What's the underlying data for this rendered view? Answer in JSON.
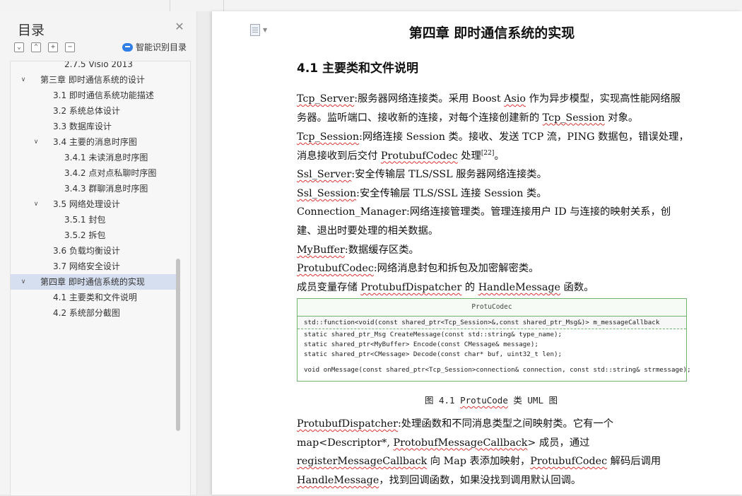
{
  "sidebar": {
    "title": "目录",
    "smart_label": "智能识别目录",
    "toc": [
      {
        "label": "2.7.5 Visio 2013",
        "level": 4,
        "arrow": ""
      },
      {
        "label": "第三章 即时通信系统的设计",
        "level": 1,
        "arrow": "∨"
      },
      {
        "label": "3.1 即时通信系统功能描述",
        "level": 2,
        "arrow": ""
      },
      {
        "label": "3.2 系统总体设计",
        "level": 2,
        "arrow": ""
      },
      {
        "label": "3.3 数据库设计",
        "level": 2,
        "arrow": ""
      },
      {
        "label": "3.4 主要的消息时序图",
        "level": 2,
        "arrow": "∨"
      },
      {
        "label": "3.4.1 未读消息时序图",
        "level": 3,
        "arrow": ""
      },
      {
        "label": "3.4.2 点对点私聊时序图",
        "level": 3,
        "arrow": ""
      },
      {
        "label": "3.4.3 群聊消息时序图",
        "level": 3,
        "arrow": ""
      },
      {
        "label": "3.5 网络处理设计",
        "level": 2,
        "arrow": "∨"
      },
      {
        "label": "3.5.1 封包",
        "level": 3,
        "arrow": ""
      },
      {
        "label": "3.5.2 拆包",
        "level": 3,
        "arrow": ""
      },
      {
        "label": "3.6 负载均衡设计",
        "level": 2,
        "arrow": ""
      },
      {
        "label": "3.7 网络安全设计",
        "level": 2,
        "arrow": ""
      },
      {
        "label": "第四章 即时通信系统的实现",
        "level": 1,
        "arrow": "∨",
        "selected": true
      },
      {
        "label": "4.1 主要类和文件说明",
        "level": 2,
        "arrow": ""
      },
      {
        "label": "4.2 系统部分截图",
        "level": 2,
        "arrow": ""
      }
    ]
  },
  "doc": {
    "chapter_title": "第四章 即时通信系统的实现",
    "section_title": "4.1 主要类和文件说明",
    "para1": {
      "t1": "Tcp_Server",
      "t2": ":服务器网络连接类。采用 Boost ",
      "t3": "Asio",
      "t4": " 作为异步模型，实现高性能网络服务器。监听端口、接收新的连接，对每个连接创建新的 ",
      "t5": "Tcp_Session",
      "t6": " 对象。"
    },
    "para2": {
      "t1": "Tcp_Session",
      "t2": ":网络连接 Session 类。接收、发送 TCP 流，PING 数据包，错误处理，消息接收到后交付 ",
      "t3": "ProtubufCodec",
      "t4": " 处理",
      "t5": "[22]",
      "t6": "。"
    },
    "para3": {
      "t1": "Ssl_Server",
      "t2": ":安全传输层 TLS/SSL 服务器网络连接类。"
    },
    "para4": {
      "t1": "Ssl_Session",
      "t2": ":安全传输层 TLS/SSL 连接 Session 类。"
    },
    "para5": {
      "t1": "Connection_Manager:网络连接管理类。管理连接用户 ID 与连接的映射关系，创建、退出时要处理的相关数据。"
    },
    "para6": {
      "t1": "MyBuffer",
      "t2": ":数据缓存区类。"
    },
    "para7": {
      "t1": "ProtubufCodec",
      "t2": ":网络消息封包和拆包及加密解密类。"
    },
    "para8": {
      "t1": "成员变量存储 ",
      "t2": "ProtubufDispatcher",
      "t3": " 的 ",
      "t4": "HandleMessage",
      "t5": " 函数。"
    },
    "uml": {
      "class_name": "ProtuCodec",
      "attribute": "std::function<void(const shared_ptr<Tcp_Session>&,const shared_ptr_Msg&)> m_messageCallback",
      "methods": [
        "static shared_ptr_Msg CreateMessage(const std::string& type_name);",
        "static shared_ptr<MyBuffer> Encode(const CMessage& message);",
        "static shared_ptr<CMessage>  Decode(const char* buf, uint32_t len);",
        "void onMessage(const shared_ptr<Tcp_Session>connection& connection, const std::string& strmessage);"
      ]
    },
    "caption": {
      "t1": "图 4.1 ",
      "t2": "ProtuCode",
      "t3": " 类 UML 图"
    },
    "para9": {
      "t1": "ProtubufDispatcher",
      "t2": ":处理函数和不同消息类型之间映射类。它有一个 map<Descriptor*, ",
      "t3": "ProtobufMessageCallback",
      "t4": "> 成员，通过 ",
      "t5": "registerMessageCallback",
      "t6": " 向 Map 表添加映射，",
      "t7": "ProtubufCodec",
      "t8": " 解码后调用 ",
      "t9": "HandleMessage",
      "t10": "，找到回调函数，如果没找到调用默认回调。"
    }
  }
}
